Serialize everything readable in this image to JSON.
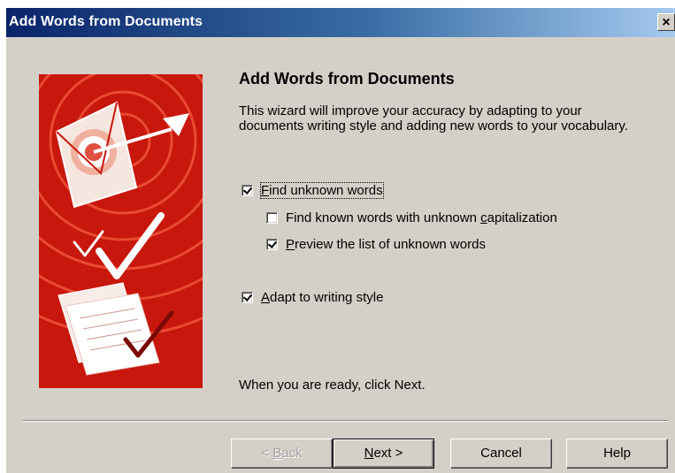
{
  "window": {
    "title": "Add Words from Documents",
    "close_glyph": "×"
  },
  "art": {
    "icons": [
      "target-envelope-icon",
      "checkmark-icon",
      "documents-checkmark-icon"
    ],
    "colors": {
      "background": "#c8170c",
      "rings": "#ea4a33",
      "white": "#ffffff"
    }
  },
  "content": {
    "heading": "Add Words from Documents",
    "intro": "This wizard will improve your accuracy by adapting to your documents writing style and adding new words to your vocabulary.",
    "options": [
      {
        "label": "Find unknown words",
        "checked": true,
        "mnemonic": "F",
        "rest": "ind unknown words"
      },
      {
        "label": "Find known words with unknown capitalization",
        "checked": false,
        "prefix": "Find known words with unknown ",
        "mnemonic": "c",
        "rest": "apitalization"
      },
      {
        "label": "Preview the list of unknown words",
        "checked": true,
        "mnemonic": "P",
        "rest": "review the list of unknown words"
      },
      {
        "label": "Adapt to writing style",
        "checked": true,
        "mnemonic": "A",
        "rest": "dapt to writing style"
      }
    ],
    "ready_text": "When you are ready, click Next."
  },
  "buttons": {
    "back": {
      "prefix": "< ",
      "mnemonic": "B",
      "rest": "ack",
      "enabled": false
    },
    "next": {
      "mnemonic": "N",
      "rest": "ext >",
      "enabled": true
    },
    "cancel": {
      "label": "Cancel"
    },
    "help": {
      "label": "Help"
    }
  }
}
